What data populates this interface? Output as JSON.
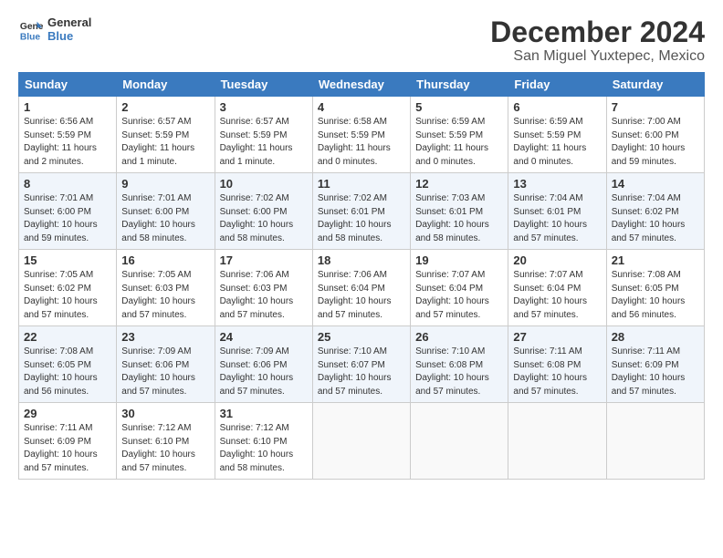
{
  "logo": {
    "line1": "General",
    "line2": "Blue"
  },
  "title": "December 2024",
  "location": "San Miguel Yuxtepec, Mexico",
  "days_of_week": [
    "Sunday",
    "Monday",
    "Tuesday",
    "Wednesday",
    "Thursday",
    "Friday",
    "Saturday"
  ],
  "weeks": [
    [
      {
        "day": "1",
        "lines": [
          "Sunrise: 6:56 AM",
          "Sunset: 5:59 PM",
          "Daylight: 11 hours",
          "and 2 minutes."
        ]
      },
      {
        "day": "2",
        "lines": [
          "Sunrise: 6:57 AM",
          "Sunset: 5:59 PM",
          "Daylight: 11 hours",
          "and 1 minute."
        ]
      },
      {
        "day": "3",
        "lines": [
          "Sunrise: 6:57 AM",
          "Sunset: 5:59 PM",
          "Daylight: 11 hours",
          "and 1 minute."
        ]
      },
      {
        "day": "4",
        "lines": [
          "Sunrise: 6:58 AM",
          "Sunset: 5:59 PM",
          "Daylight: 11 hours",
          "and 0 minutes."
        ]
      },
      {
        "day": "5",
        "lines": [
          "Sunrise: 6:59 AM",
          "Sunset: 5:59 PM",
          "Daylight: 11 hours",
          "and 0 minutes."
        ]
      },
      {
        "day": "6",
        "lines": [
          "Sunrise: 6:59 AM",
          "Sunset: 5:59 PM",
          "Daylight: 11 hours",
          "and 0 minutes."
        ]
      },
      {
        "day": "7",
        "lines": [
          "Sunrise: 7:00 AM",
          "Sunset: 6:00 PM",
          "Daylight: 10 hours",
          "and 59 minutes."
        ]
      }
    ],
    [
      {
        "day": "8",
        "lines": [
          "Sunrise: 7:01 AM",
          "Sunset: 6:00 PM",
          "Daylight: 10 hours",
          "and 59 minutes."
        ]
      },
      {
        "day": "9",
        "lines": [
          "Sunrise: 7:01 AM",
          "Sunset: 6:00 PM",
          "Daylight: 10 hours",
          "and 58 minutes."
        ]
      },
      {
        "day": "10",
        "lines": [
          "Sunrise: 7:02 AM",
          "Sunset: 6:00 PM",
          "Daylight: 10 hours",
          "and 58 minutes."
        ]
      },
      {
        "day": "11",
        "lines": [
          "Sunrise: 7:02 AM",
          "Sunset: 6:01 PM",
          "Daylight: 10 hours",
          "and 58 minutes."
        ]
      },
      {
        "day": "12",
        "lines": [
          "Sunrise: 7:03 AM",
          "Sunset: 6:01 PM",
          "Daylight: 10 hours",
          "and 58 minutes."
        ]
      },
      {
        "day": "13",
        "lines": [
          "Sunrise: 7:04 AM",
          "Sunset: 6:01 PM",
          "Daylight: 10 hours",
          "and 57 minutes."
        ]
      },
      {
        "day": "14",
        "lines": [
          "Sunrise: 7:04 AM",
          "Sunset: 6:02 PM",
          "Daylight: 10 hours",
          "and 57 minutes."
        ]
      }
    ],
    [
      {
        "day": "15",
        "lines": [
          "Sunrise: 7:05 AM",
          "Sunset: 6:02 PM",
          "Daylight: 10 hours",
          "and 57 minutes."
        ]
      },
      {
        "day": "16",
        "lines": [
          "Sunrise: 7:05 AM",
          "Sunset: 6:03 PM",
          "Daylight: 10 hours",
          "and 57 minutes."
        ]
      },
      {
        "day": "17",
        "lines": [
          "Sunrise: 7:06 AM",
          "Sunset: 6:03 PM",
          "Daylight: 10 hours",
          "and 57 minutes."
        ]
      },
      {
        "day": "18",
        "lines": [
          "Sunrise: 7:06 AM",
          "Sunset: 6:04 PM",
          "Daylight: 10 hours",
          "and 57 minutes."
        ]
      },
      {
        "day": "19",
        "lines": [
          "Sunrise: 7:07 AM",
          "Sunset: 6:04 PM",
          "Daylight: 10 hours",
          "and 57 minutes."
        ]
      },
      {
        "day": "20",
        "lines": [
          "Sunrise: 7:07 AM",
          "Sunset: 6:04 PM",
          "Daylight: 10 hours",
          "and 57 minutes."
        ]
      },
      {
        "day": "21",
        "lines": [
          "Sunrise: 7:08 AM",
          "Sunset: 6:05 PM",
          "Daylight: 10 hours",
          "and 56 minutes."
        ]
      }
    ],
    [
      {
        "day": "22",
        "lines": [
          "Sunrise: 7:08 AM",
          "Sunset: 6:05 PM",
          "Daylight: 10 hours",
          "and 56 minutes."
        ]
      },
      {
        "day": "23",
        "lines": [
          "Sunrise: 7:09 AM",
          "Sunset: 6:06 PM",
          "Daylight: 10 hours",
          "and 57 minutes."
        ]
      },
      {
        "day": "24",
        "lines": [
          "Sunrise: 7:09 AM",
          "Sunset: 6:06 PM",
          "Daylight: 10 hours",
          "and 57 minutes."
        ]
      },
      {
        "day": "25",
        "lines": [
          "Sunrise: 7:10 AM",
          "Sunset: 6:07 PM",
          "Daylight: 10 hours",
          "and 57 minutes."
        ]
      },
      {
        "day": "26",
        "lines": [
          "Sunrise: 7:10 AM",
          "Sunset: 6:08 PM",
          "Daylight: 10 hours",
          "and 57 minutes."
        ]
      },
      {
        "day": "27",
        "lines": [
          "Sunrise: 7:11 AM",
          "Sunset: 6:08 PM",
          "Daylight: 10 hours",
          "and 57 minutes."
        ]
      },
      {
        "day": "28",
        "lines": [
          "Sunrise: 7:11 AM",
          "Sunset: 6:09 PM",
          "Daylight: 10 hours",
          "and 57 minutes."
        ]
      }
    ],
    [
      {
        "day": "29",
        "lines": [
          "Sunrise: 7:11 AM",
          "Sunset: 6:09 PM",
          "Daylight: 10 hours",
          "and 57 minutes."
        ]
      },
      {
        "day": "30",
        "lines": [
          "Sunrise: 7:12 AM",
          "Sunset: 6:10 PM",
          "Daylight: 10 hours",
          "and 57 minutes."
        ]
      },
      {
        "day": "31",
        "lines": [
          "Sunrise: 7:12 AM",
          "Sunset: 6:10 PM",
          "Daylight: 10 hours",
          "and 58 minutes."
        ]
      },
      {
        "day": "",
        "lines": []
      },
      {
        "day": "",
        "lines": []
      },
      {
        "day": "",
        "lines": []
      },
      {
        "day": "",
        "lines": []
      }
    ]
  ]
}
